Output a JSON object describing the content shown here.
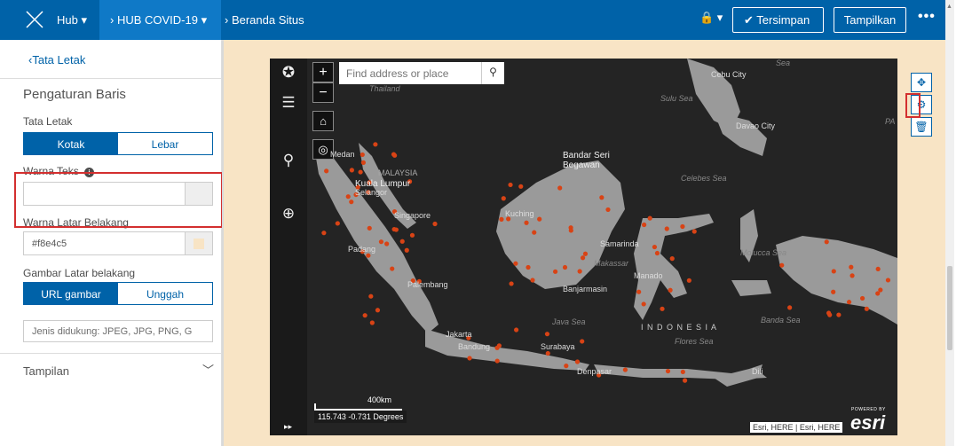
{
  "topbar": {
    "hub_label": "Hub ▾",
    "site_tab_label": "› HUB COVID-19 ▾",
    "breadcrumb": "› Beranda Situs",
    "lock_label": "🔒 ▾",
    "saved_label": "✔ Tersimpan",
    "view_label": "Tampilkan",
    "more_label": "•••"
  },
  "panel": {
    "back_label": "Tata Letak",
    "title": "Pengaturan Baris",
    "layout_label": "Tata Letak",
    "layout_options": [
      "Kotak",
      "Lebar"
    ],
    "text_color_label": "Warna Teks",
    "text_color_value": "",
    "bg_color_label": "Warna Latar Belakang",
    "bg_color_value": "#f8e4c5",
    "bg_image_label": "Gambar Latar belakang",
    "bg_image_options": [
      "URL gambar",
      "Unggah"
    ],
    "supported_types": "Jenis didukung: JPEG, JPG, PNG, G",
    "display_label": "Tampilan",
    "info_icon": "info-icon"
  },
  "map": {
    "search_placeholder": "Find address or place",
    "zoom_in": "+",
    "zoom_out": "−",
    "scale_label": "400km",
    "coords": "115.743 -0.731 Degrees",
    "attribution": "Esri, HERE | Esri, HERE",
    "powered_by": "POWERED BY",
    "esri_logo": "esri",
    "labels": {
      "cebu": "Cebu City",
      "davao": "Davao City",
      "sulu": "Sulu Sea",
      "celebes": "Celebes Sea",
      "malaysia": "MALAYSIA",
      "kl": "Kuala Lumpur",
      "selangor": "Selangor",
      "singapore": "Singapore",
      "bandar": "Bandar Seri Begawan",
      "medan": "Medan",
      "padang": "Padang",
      "jakarta": "Jakarta",
      "bandung": "Bandung",
      "surabaya": "Surabaya",
      "denpasar": "Denpasar",
      "makassar": "Makassar",
      "manado": "Manado",
      "samarinda": "Samarinda",
      "banjarmasin": "Banjarmasin",
      "palembang": "Palembang",
      "kuching": "Kuching",
      "indonesia": "I N D O N E S I A",
      "java_sea": "Java Sea",
      "flores_sea": "Flores Sea",
      "banda_sea": "Banda Sea",
      "molucca": "Molucca Sea",
      "dili": "Dili",
      "thailand": "Thailand",
      "sea": "Sea",
      "pa": "PA"
    }
  },
  "tools": [
    "move-icon",
    "gear-icon",
    "trash-icon"
  ],
  "accent_color": "#0062a8",
  "highlight_color": "#d32f2f",
  "page_bg_color": "#f8e4c5"
}
